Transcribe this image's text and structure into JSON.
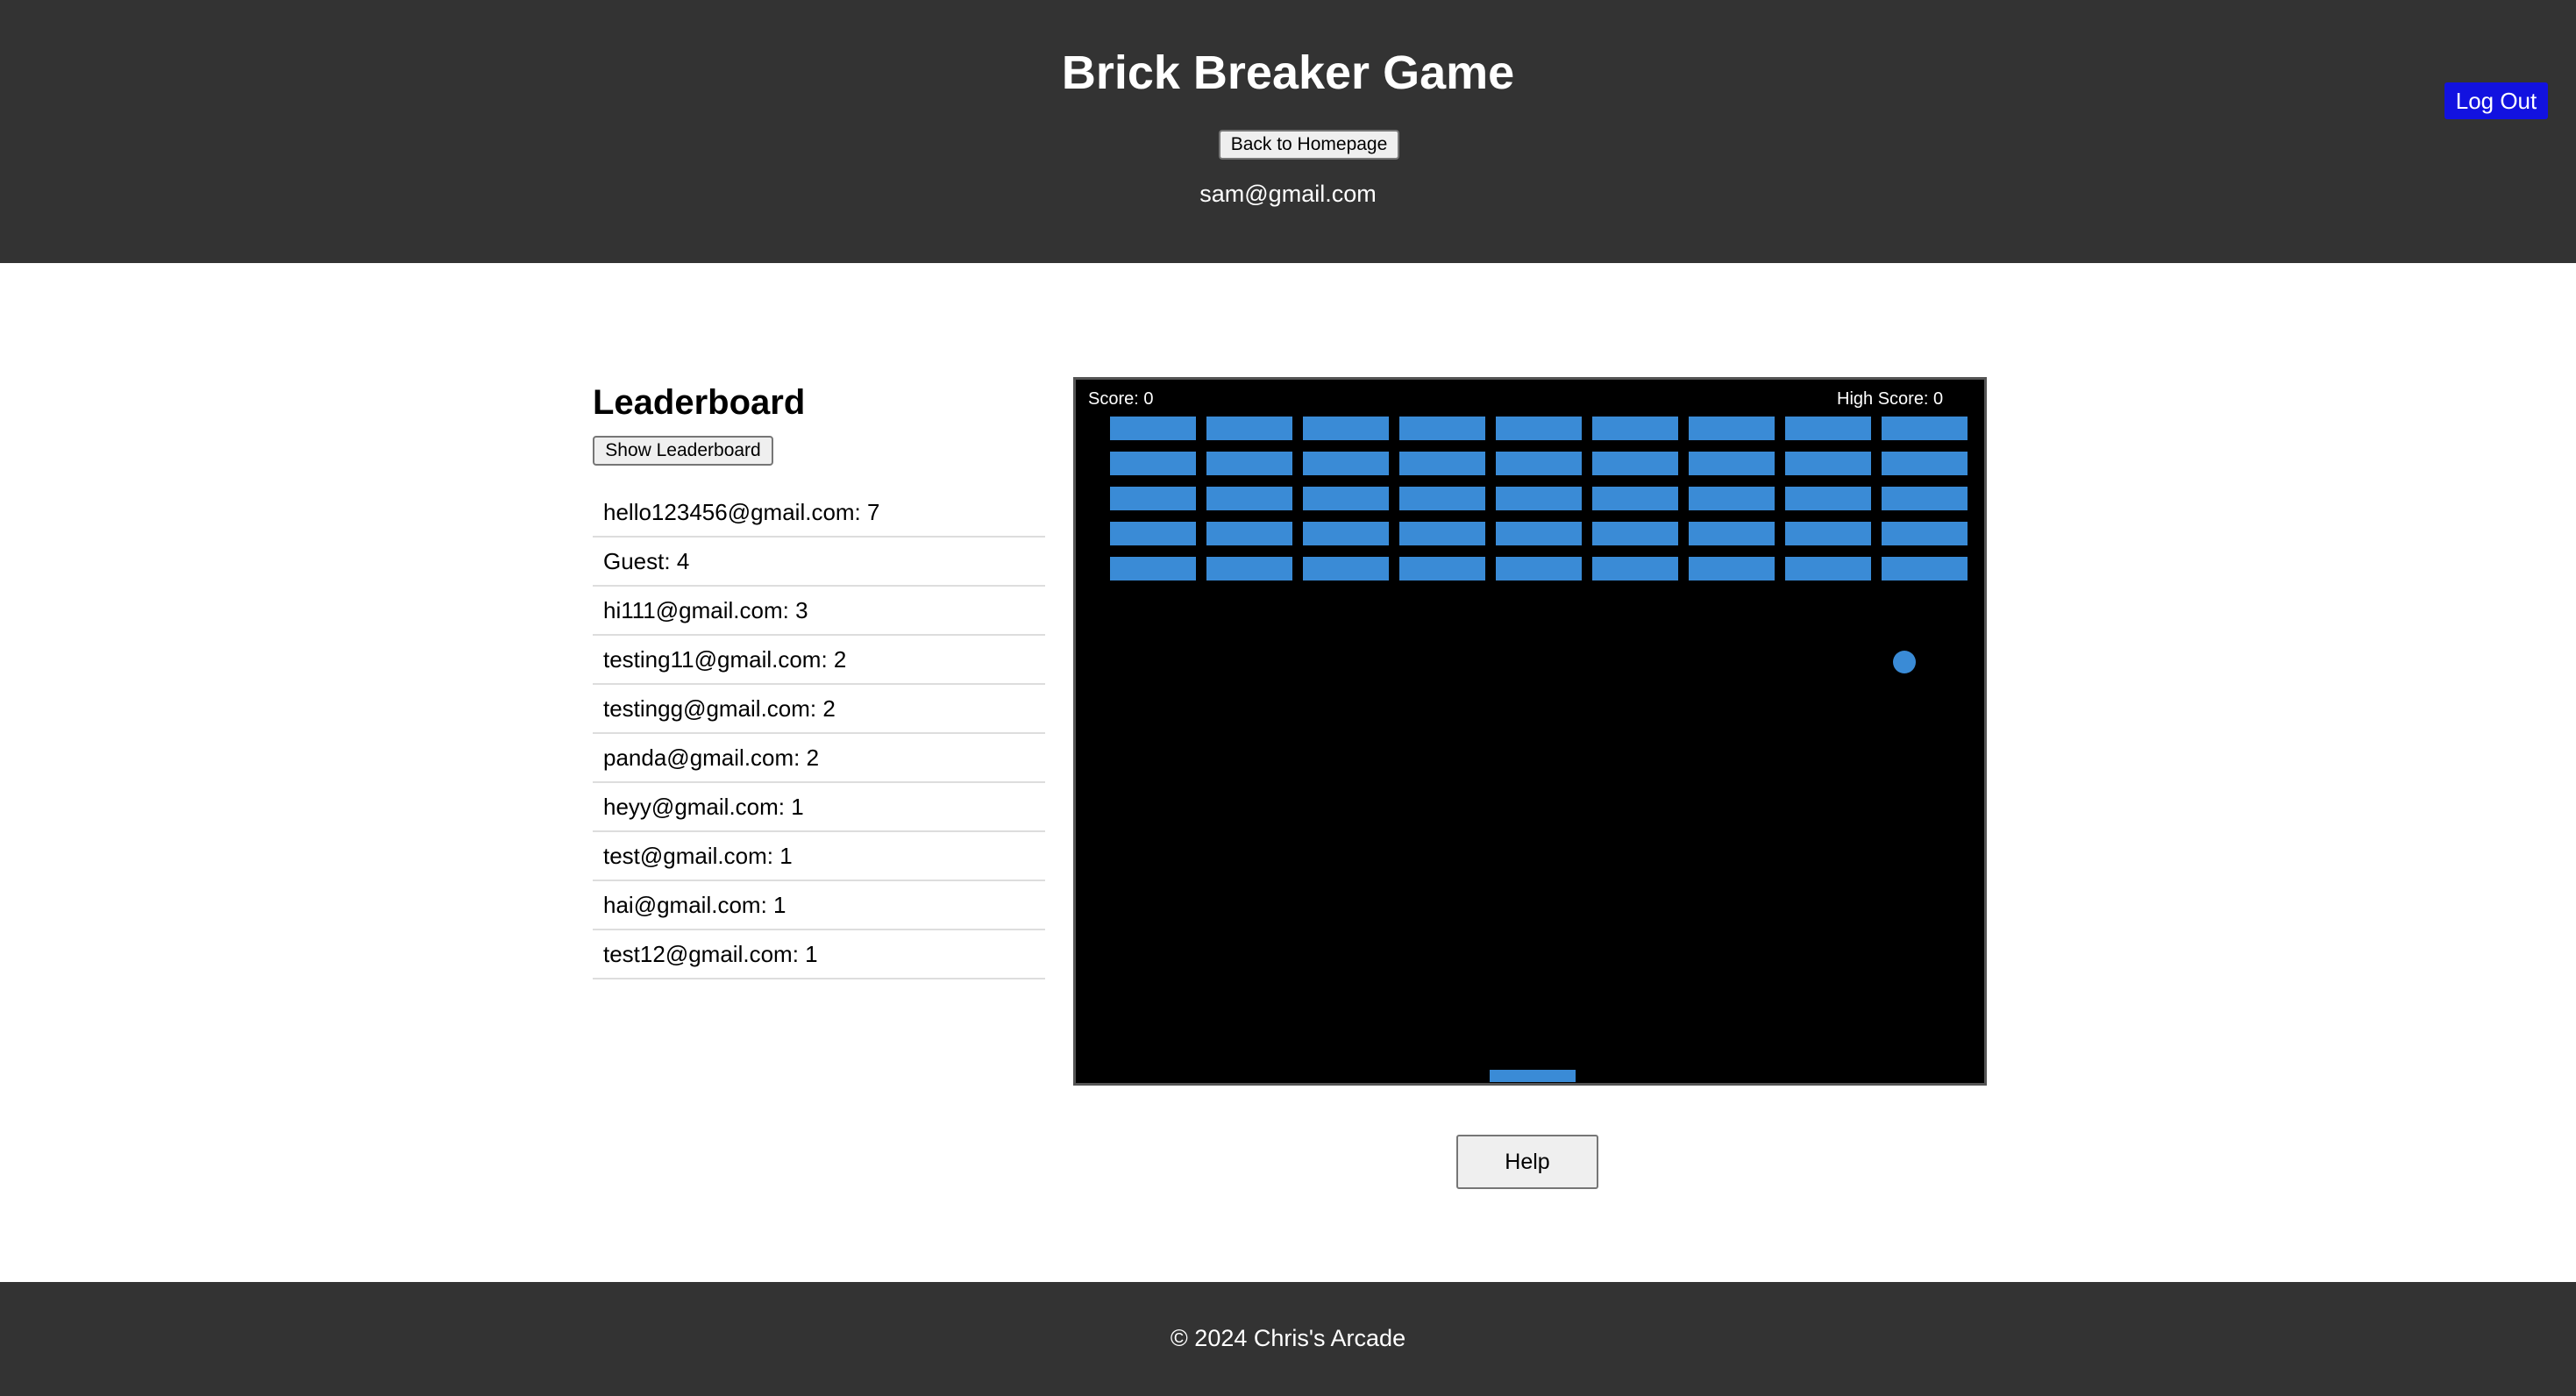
{
  "header": {
    "title": "Brick Breaker Game",
    "home_button": "Back to Homepage",
    "user_email": "sam@gmail.com",
    "logout_button": "Log Out"
  },
  "leaderboard": {
    "title": "Leaderboard",
    "show_button": "Show Leaderboard",
    "entries": [
      "hello123456@gmail.com: 7",
      "Guest: 4",
      "hi111@gmail.com: 3",
      "testing11@gmail.com: 2",
      "testingg@gmail.com: 2",
      "panda@gmail.com: 2",
      "heyy@gmail.com: 1",
      "test@gmail.com: 1",
      "hai@gmail.com: 1",
      "test12@gmail.com: 1"
    ]
  },
  "game": {
    "score_text": "Score: 0",
    "high_score_text": "High Score: 0",
    "brick_rows": 5,
    "brick_columns": 9,
    "brick_color": "#3a8bd6",
    "background_color": "#000000"
  },
  "help_button": "Help",
  "footer": {
    "text": "© 2024 Chris's Arcade"
  },
  "colors": {
    "header_bg": "#333333",
    "logout_bg": "#1212e0"
  }
}
